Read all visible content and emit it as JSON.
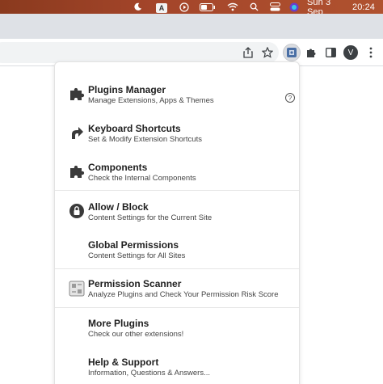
{
  "menubar": {
    "icons": [
      "moon-icon",
      "a-icon",
      "play-icon",
      "battery-icon",
      "wifi-icon",
      "search-icon",
      "control-center-icon",
      "siri-icon"
    ],
    "a_label": "A",
    "date": "Sun 3 Sep",
    "time": "20:24"
  },
  "toolbar": {
    "avatar_initial": "V",
    "icons": [
      "share-icon",
      "bookmark-star-icon",
      "extension-active-icon",
      "puzzle-icon",
      "sidepanel-icon",
      "more-vertical-icon"
    ]
  },
  "menu": {
    "items": [
      {
        "title": "Plugins Manager",
        "desc": "Manage Extensions, Apps & Themes",
        "icon": "puzzle-icon",
        "has_help": true
      },
      {
        "title": "Keyboard Shortcuts",
        "desc": "Set & Modify Extension Shortcuts",
        "icon": "curved-arrow-icon"
      },
      {
        "title": "Components",
        "desc": "Check the Internal Components",
        "icon": "puzzle-icon"
      },
      {
        "title": "Allow / Block",
        "desc": "Content Settings for the Current Site",
        "icon": "lock-icon"
      },
      {
        "title": "Global Permissions",
        "desc": "Content Settings for All Sites",
        "icon": ""
      },
      {
        "title": "Permission Scanner",
        "desc": "Analyze Plugins and Check Your Permission Risk Score",
        "icon": "scanner-icon"
      },
      {
        "title": "More Plugins",
        "desc": "Check our other extensions!",
        "icon": ""
      },
      {
        "title": "Help & Support",
        "desc": "Information, Questions & Answers...",
        "icon": ""
      }
    ],
    "help_glyph": "?"
  }
}
